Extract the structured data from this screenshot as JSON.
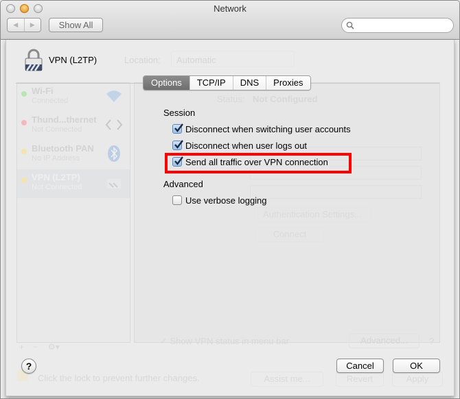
{
  "window": {
    "title": "Network",
    "nav_back": "◀",
    "nav_forward": "▶",
    "show_all": "Show All",
    "search_placeholder": ""
  },
  "header": {
    "service_title": "VPN (L2TP)",
    "location_label": "Location:",
    "location_value": "Automatic",
    "lock_hint": "Click the lock to prevent further changes."
  },
  "sidebar": {
    "services": [
      {
        "name": "Wi-Fi",
        "status": "Connected",
        "status_color": "#8fd88a",
        "icon": "wifi-icon"
      },
      {
        "name": "Thund...thernet",
        "status": "Not Connected",
        "status_color": "#f09aa0",
        "icon": "ethernet-icon"
      },
      {
        "name": "Bluetooth PAN",
        "status": "No IP Address",
        "status_color": "#f5dc8c",
        "icon": "bluetooth-icon"
      },
      {
        "name": "VPN (L2TP)",
        "status": "Not Connected",
        "status_color": "#f5dc8c",
        "icon": "vpn-icon"
      }
    ],
    "add_label": "+",
    "remove_label": "−",
    "gear_label": "⚙▾"
  },
  "background_pane": {
    "status_label": "Status:",
    "status_value": "Not Configured",
    "auth_button": "Authentication Settings...",
    "connect_button": "Connect",
    "show_vpn_status": "Show VPN status in menu bar",
    "advanced_button": "Advanced...",
    "help": "?"
  },
  "tabs": [
    {
      "label": "Options",
      "active": true
    },
    {
      "label": "TCP/IP",
      "active": false
    },
    {
      "label": "DNS",
      "active": false
    },
    {
      "label": "Proxies",
      "active": false
    }
  ],
  "options": {
    "session_heading": "Session",
    "session_items": [
      {
        "label": "Disconnect when switching user accounts",
        "checked": true
      },
      {
        "label": "Disconnect when user logs out",
        "checked": true
      },
      {
        "label": "Send all traffic over VPN connection",
        "checked": true
      }
    ],
    "advanced_heading": "Advanced",
    "advanced_items": [
      {
        "label": "Use verbose logging",
        "checked": false
      }
    ],
    "highlight_color": "#ff0000"
  },
  "footer": {
    "help": "?",
    "cancel": "Cancel",
    "ok": "OK",
    "assist": "Assist me...",
    "revert": "Revert",
    "apply": "Apply"
  }
}
